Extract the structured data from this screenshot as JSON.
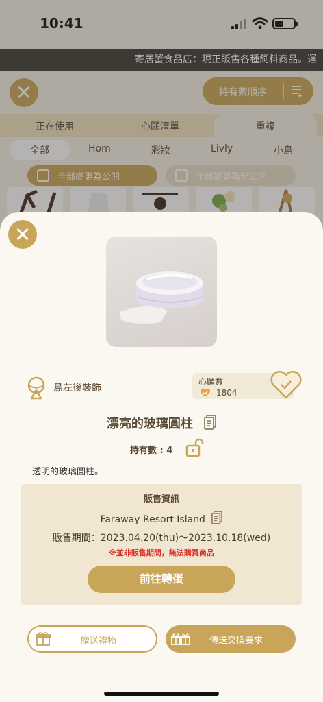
{
  "status_bar": {
    "time": "10:41"
  },
  "ticker": {
    "text": "寄居蟹食品店：現正販售各種飼料商品。運"
  },
  "header": {
    "sort_label": "持有數順序"
  },
  "tabs": [
    {
      "label": "正在使用"
    },
    {
      "label": "心願清單"
    },
    {
      "label": "重複"
    }
  ],
  "categories": [
    {
      "label": "全部"
    },
    {
      "label": "Hom"
    },
    {
      "label": "彩妝"
    },
    {
      "label": "Livly"
    },
    {
      "label": "小島"
    }
  ],
  "visibility": {
    "public_label": "全部變更為公開",
    "private_label": "全部變更為非公開"
  },
  "item": {
    "category_label": "島左後裝飾",
    "wishlist_label": "心願數",
    "wishlist_count": "1804",
    "name": "漂亮的玻璃圓柱",
    "owned": "持有數 : 4",
    "description": "透明的玻璃圓柱。"
  },
  "sale": {
    "title": "販售資訊",
    "location": "Faraway Resort Island",
    "period": "販售期間：2023.04.20(thu)〜2023.10.18(wed)",
    "warning": "※並非販售期間，無法購買商品",
    "go_label": "前往轉蛋"
  },
  "actions": {
    "gift_label": "贈送禮物",
    "trade_label": "傳送交換要求"
  },
  "colors": {
    "accent_gold": "#c9a55a",
    "sheet_bg": "#fbf8f1",
    "sale_bg": "#f1e6d1",
    "warning_red": "#d93025"
  }
}
